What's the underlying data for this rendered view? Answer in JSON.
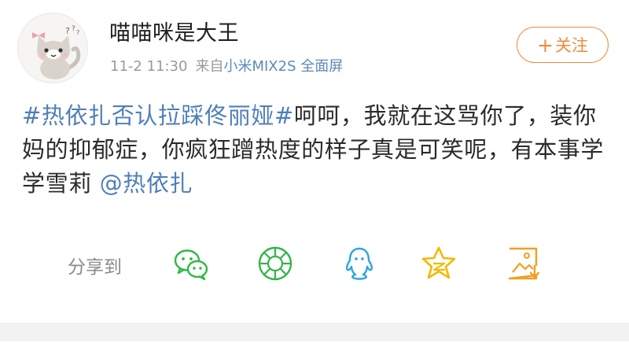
{
  "post": {
    "username": "喵喵咪是大王",
    "date": "11-2 11:30",
    "source_prefix": "来自",
    "device": "小米MIX2S 全面屏",
    "follow_label": "关注",
    "follow_plus": "+",
    "topic": "#热依扎否认拉踩佟丽娅#",
    "body": "呵呵，我就在这骂你了，装你妈的抑郁症，你疯狂蹭热度的样子真是可笑呢，有本事学学雪莉",
    "mention": "@热依扎"
  },
  "share": {
    "label": "分享到",
    "targets": [
      {
        "name": "wechat",
        "icon": "wechat-icon",
        "color": "#2fb845"
      },
      {
        "name": "moments",
        "icon": "moments-icon",
        "color": "#34b34a"
      },
      {
        "name": "qq",
        "icon": "qq-icon",
        "color": "#2ba5e0"
      },
      {
        "name": "qzone",
        "icon": "qzone-icon",
        "color": "#f5b800"
      },
      {
        "name": "save-image",
        "icon": "save-image-icon",
        "color": "#f0a020"
      }
    ]
  },
  "colors": {
    "link": "#4f7fb8",
    "follow": "#f08a3b",
    "meta": "#9a9a9a"
  }
}
